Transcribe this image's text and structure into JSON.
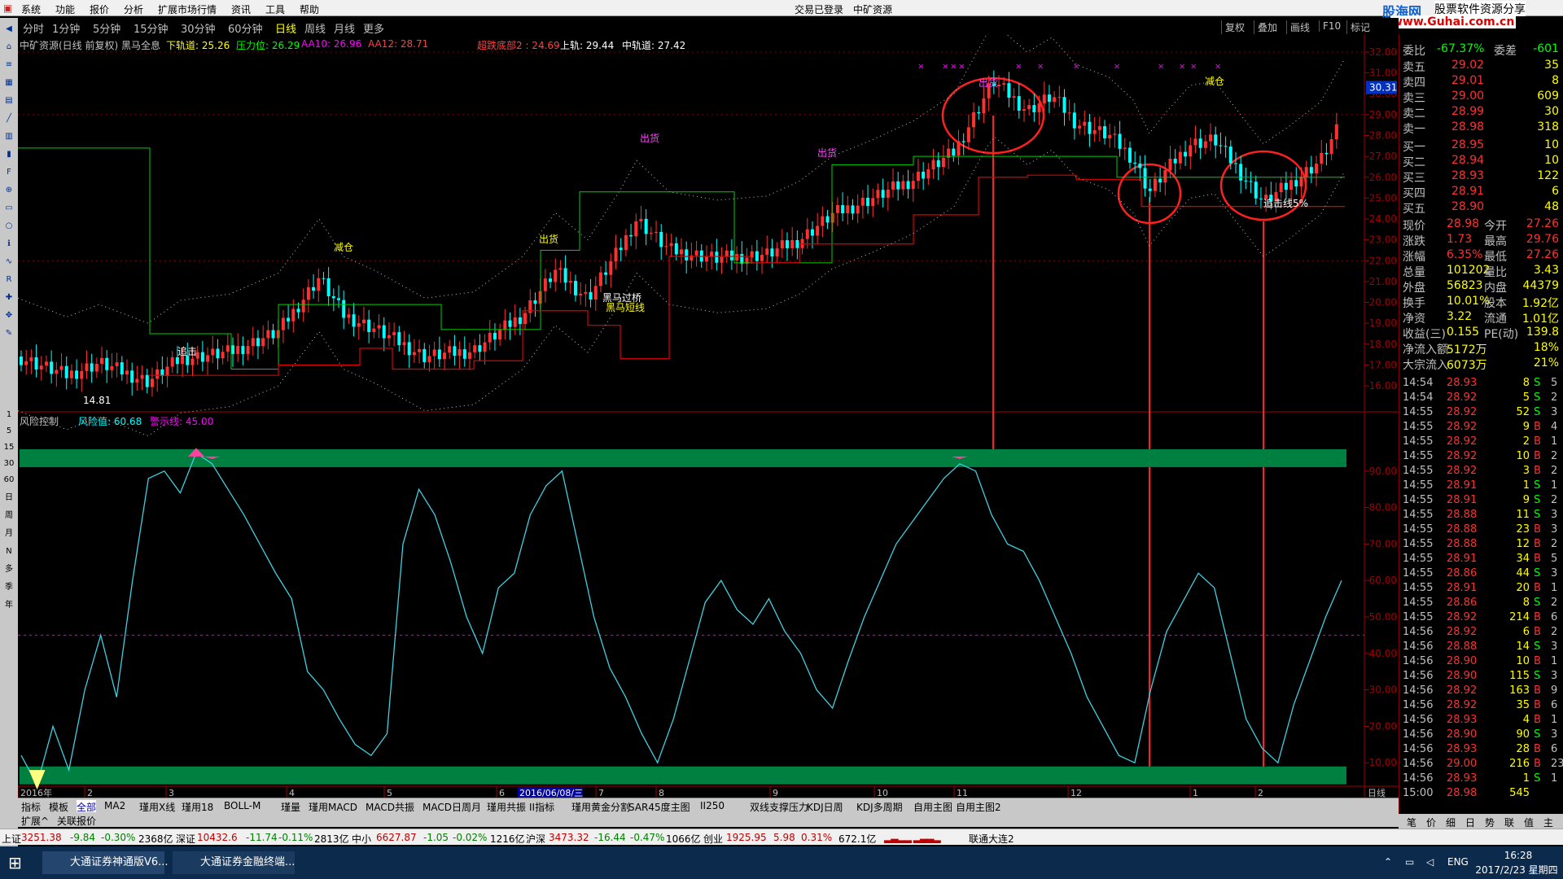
{
  "menu": [
    "系统",
    "功能",
    "报价",
    "分析",
    "扩展市场行情",
    "资讯",
    "工具",
    "帮助"
  ],
  "window_center": [
    "交易已登录",
    "中矿资源"
  ],
  "logo_text": "股海网",
  "logo_sub": "股票软件资源分享",
  "logo_url": "www.Guhai.com.cn",
  "periods": [
    "分时",
    "1分钟",
    "5分钟",
    "15分钟",
    "30分钟",
    "60分钟",
    "日线",
    "周线",
    "月线",
    "更多"
  ],
  "active_period": "日线",
  "toolbar_right": [
    "复权",
    "叠加",
    "画线",
    "F10",
    "标记"
  ],
  "main_info": {
    "title": "中矿资源(日线 前复权) 黑马全息",
    "xia": "下轨道: 25.26",
    "ya": "压力位: 26.29",
    "aa10": "AA10: 26.96",
    "aa12": "AA12: 28.71",
    "chaodie": "超跌底部2 : 24.69",
    "shang": "上轨: 29.44",
    "zhong": "中轨道: 27.42"
  },
  "sub_info": {
    "title": "风险控制",
    "risk": "风险值: 60.68",
    "warn": "警示线: 45.00"
  },
  "price_axis": [
    "32.00",
    "31.00",
    "30.00",
    "29.00",
    "28.00",
    "27.00",
    "26.00",
    "25.00",
    "24.00",
    "23.00",
    "22.00",
    "21.00",
    "20.00",
    "19.00",
    "18.00",
    "17.00",
    "16.00"
  ],
  "risk_axis": [
    "90.00",
    "80.00",
    "70.00",
    "60.00",
    "50.00",
    "40.00",
    "30.00",
    "20.00",
    "10.00"
  ],
  "current_price_tag": "30.31",
  "date_axis": [
    "2016年",
    "2",
    "3",
    "4",
    "5",
    "6",
    "7",
    "8",
    "9",
    "10",
    "11",
    "12",
    "1",
    "2"
  ],
  "highlight_date": "2016/06/08/三",
  "bottom_right_label": "日线",
  "chart_labels": {
    "low_mark": "14.81",
    "chuhuo1": "出货",
    "chuhuo2": "出货",
    "chuhuo3": "出货",
    "chuhuo4": "出货",
    "chuhuo5": "出货",
    "jiancang": "减仓",
    "heima": "黑马短线",
    "heima_guoqiao": "黑马过桥",
    "zhuiji": "追击",
    "zhuiji_pct": "追击线5%"
  },
  "chart_data": {
    "type": "line",
    "main": {
      "title": "中矿资源(日线 前复权) 黑马全息",
      "ylim": [
        16,
        32
      ],
      "low": 14.81,
      "last_close": 28.98
    },
    "risk_control": {
      "title": "风险控制",
      "ylim": [
        0,
        100
      ],
      "warning_line": 45,
      "values": [
        12,
        4,
        20,
        8,
        30,
        45,
        28,
        60,
        88,
        90,
        84,
        95,
        92,
        85,
        78,
        70,
        62,
        55,
        35,
        30,
        22,
        15,
        12,
        18,
        70,
        85,
        78,
        65,
        50,
        40,
        58,
        62,
        78,
        86,
        90,
        70,
        50,
        36,
        28,
        18,
        10,
        22,
        38,
        54,
        60,
        52,
        48,
        55,
        46,
        40,
        30,
        25,
        38,
        50,
        60,
        70,
        76,
        82,
        88,
        92,
        90,
        78,
        70,
        68,
        60,
        50,
        40,
        28,
        20,
        12,
        10,
        30,
        46,
        54,
        62,
        58,
        40,
        22,
        14,
        10,
        26,
        38,
        50,
        60
      ]
    }
  },
  "quote": {
    "weibi": "委比",
    "weibi_v": "-67.37%",
    "weicha": "委差",
    "weicha_v": "-601",
    "sell": [
      {
        "l": "卖五",
        "p": "29.02",
        "v": "35"
      },
      {
        "l": "卖四",
        "p": "29.01",
        "v": "8"
      },
      {
        "l": "卖三",
        "p": "29.00",
        "v": "609"
      },
      {
        "l": "卖二",
        "p": "28.99",
        "v": "30"
      },
      {
        "l": "卖一",
        "p": "28.98",
        "v": "318"
      }
    ],
    "buy": [
      {
        "l": "买一",
        "p": "28.95",
        "v": "10"
      },
      {
        "l": "买二",
        "p": "28.94",
        "v": "10"
      },
      {
        "l": "买三",
        "p": "28.93",
        "v": "122"
      },
      {
        "l": "买四",
        "p": "28.91",
        "v": "6"
      },
      {
        "l": "买五",
        "p": "28.90",
        "v": "48"
      }
    ],
    "stats": [
      {
        "a": "现价",
        "av": "28.98",
        "b": "今开",
        "bv": "27.26"
      },
      {
        "a": "涨跌",
        "av": "1.73",
        "b": "最高",
        "bv": "29.76"
      },
      {
        "a": "涨幅",
        "av": "6.35%",
        "b": "最低",
        "bv": "27.26"
      },
      {
        "a": "总量",
        "av": "101202",
        "b": "量比",
        "bv": "3.43"
      },
      {
        "a": "外盘",
        "av": "56823",
        "b": "内盘",
        "bv": "44379"
      },
      {
        "a": "换手",
        "av": "10.01%",
        "b": "股本",
        "bv": "1.92亿"
      },
      {
        "a": "净资",
        "av": "3.22",
        "b": "流通",
        "bv": "1.01亿"
      },
      {
        "a": "收益(三)",
        "av": "0.155",
        "b": "PE(动)",
        "bv": "139.8"
      },
      {
        "a": "净流入额",
        "av": "5172万",
        "b": "",
        "bv": "18%"
      },
      {
        "a": "大宗流入",
        "av": "6073万",
        "b": "",
        "bv": "21%"
      }
    ],
    "ticks": [
      [
        "14:54",
        "28.93",
        "8",
        "S",
        "5"
      ],
      [
        "14:54",
        "28.92",
        "5",
        "S",
        "2"
      ],
      [
        "14:55",
        "28.92",
        "52",
        "S",
        "3"
      ],
      [
        "14:55",
        "28.92",
        "9",
        "B",
        "4"
      ],
      [
        "14:55",
        "28.92",
        "2",
        "B",
        "1"
      ],
      [
        "14:55",
        "28.92",
        "10",
        "B",
        "2"
      ],
      [
        "14:55",
        "28.92",
        "3",
        "B",
        "2"
      ],
      [
        "14:55",
        "28.91",
        "1",
        "S",
        "1"
      ],
      [
        "14:55",
        "28.91",
        "9",
        "S",
        "2"
      ],
      [
        "14:55",
        "28.88",
        "11",
        "S",
        "3"
      ],
      [
        "14:55",
        "28.88",
        "23",
        "B",
        "3"
      ],
      [
        "14:55",
        "28.88",
        "12",
        "B",
        "2"
      ],
      [
        "14:55",
        "28.91",
        "34",
        "B",
        "5"
      ],
      [
        "14:55",
        "28.86",
        "44",
        "S",
        "3"
      ],
      [
        "14:55",
        "28.91",
        "20",
        "B",
        "1"
      ],
      [
        "14:55",
        "28.86",
        "8",
        "S",
        "2"
      ],
      [
        "14:55",
        "28.92",
        "214",
        "B",
        "6"
      ],
      [
        "14:56",
        "28.92",
        "6",
        "B",
        "2"
      ],
      [
        "14:56",
        "28.88",
        "14",
        "S",
        "3"
      ],
      [
        "14:56",
        "28.90",
        "10",
        "B",
        "1"
      ],
      [
        "14:56",
        "28.90",
        "115",
        "S",
        "3"
      ],
      [
        "14:56",
        "28.92",
        "163",
        "B",
        "9"
      ],
      [
        "14:56",
        "28.92",
        "35",
        "B",
        "6"
      ],
      [
        "14:56",
        "28.93",
        "4",
        "B",
        "1"
      ],
      [
        "14:56",
        "28.90",
        "90",
        "S",
        "3"
      ],
      [
        "14:56",
        "28.93",
        "28",
        "B",
        "6"
      ],
      [
        "14:56",
        "29.00",
        "216",
        "B",
        "23"
      ],
      [
        "14:56",
        "28.93",
        "1",
        "S",
        "1"
      ],
      [
        "15:00",
        "28.98",
        "545",
        "",
        ""
      ]
    ]
  },
  "bottom_panel_tabs": [
    "笔",
    "价",
    "细",
    "日",
    "势",
    "联",
    "值",
    "主"
  ],
  "tabs": [
    "指标",
    "模板",
    "全部",
    "MA2",
    "瑾用X线",
    "瑾用18",
    "BOLL-M",
    "瑾量",
    "瑾用MACD",
    "MACD共振",
    "MACD日周月",
    "瑾用共振",
    "II指标",
    "瑾用黄金分割",
    "SAR45度主图",
    "II250",
    "双线支撑压力",
    "KDJ日周",
    "KDJ多周期",
    "自用主图",
    "自用主图2"
  ],
  "active_tab": "全部",
  "tabs2": [
    "扩展^",
    "关联报价"
  ],
  "status": {
    "sh": "上证",
    "sh_v": "3251.38",
    "sh_c": "-9.84",
    "sh_p": "-0.30%",
    "sh_a": "2368亿",
    "sz": "深证",
    "sz_v": "10432.6",
    "sz_c": "-11.74",
    "sz_p": "-0.11%",
    "sz_a": "2813亿",
    "zx": "中小",
    "zx_v": "6627.87",
    "zx_c": "-1.05",
    "zx_p": "-0.02%",
    "zx_a": "1216亿",
    "hs": "沪深",
    "hs_v": "3473.32",
    "hs_c": "-16.44",
    "hs_p": "-0.47%",
    "hs_a": "1066亿",
    "cy": "创业",
    "cy_v": "1925.95",
    "cy_c": "5.98",
    "cy_p": "0.31%",
    "cy_a": "672.1亿",
    "conn": "联通大连2"
  },
  "taskbar": {
    "task1": "大通证券神通版V6...",
    "task2": "大通证券金融终端...",
    "lang": "ENG",
    "time": "16:28",
    "date": "2017/2/23 星期四"
  }
}
